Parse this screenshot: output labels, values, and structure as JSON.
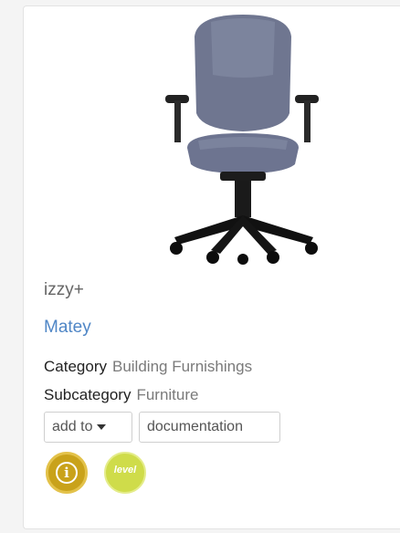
{
  "card": {
    "image_alt": "office chair",
    "brand": "izzy+",
    "product_name": "Matey",
    "category_label": "Category",
    "category_value": "Building Furnishings",
    "subcategory_label": "Subcategory",
    "subcategory_value": "Furniture",
    "add_to_label": "add to",
    "documentation_label": "documentation",
    "info_icon": "info-icon",
    "level_badge": "level"
  },
  "colors": {
    "link": "#4f86c6",
    "info_badge": "#c9a21a",
    "level_badge": "#cfdc4a"
  }
}
